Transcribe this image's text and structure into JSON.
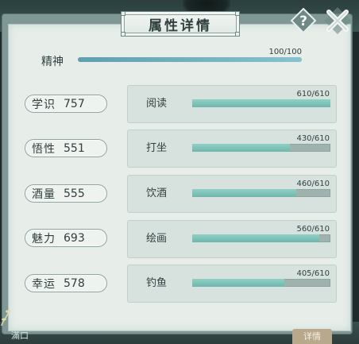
{
  "title": "属性详情",
  "header_buttons": {
    "help_icon": "help-icon",
    "close_icon": "close-icon"
  },
  "spirit": {
    "label": "精神",
    "value_text": "100/100",
    "current": 100,
    "max": 100
  },
  "stats": [
    {
      "name": "学识",
      "value": "757"
    },
    {
      "name": "悟性",
      "value": "551"
    },
    {
      "name": "酒量",
      "value": "555"
    },
    {
      "name": "魅力",
      "value": "693"
    },
    {
      "name": "幸运",
      "value": "578"
    }
  ],
  "skills": [
    {
      "name": "阅读",
      "value_text": "610/610",
      "current": 610,
      "max": 610
    },
    {
      "name": "打坐",
      "value_text": "430/610",
      "current": 430,
      "max": 610
    },
    {
      "name": "饮酒",
      "value_text": "460/610",
      "current": 460,
      "max": 610
    },
    {
      "name": "绘画",
      "value_text": "560/610",
      "current": 560,
      "max": 610
    },
    {
      "name": "钓鱼",
      "value_text": "405/610",
      "current": 405,
      "max": 610
    }
  ],
  "footer": {
    "left_text": "滿口",
    "button_label": "详情"
  },
  "colors": {
    "accent": "#7fc0b6",
    "panel": "#e7eeea",
    "frame": "#7f9895",
    "text": "#30403f"
  }
}
